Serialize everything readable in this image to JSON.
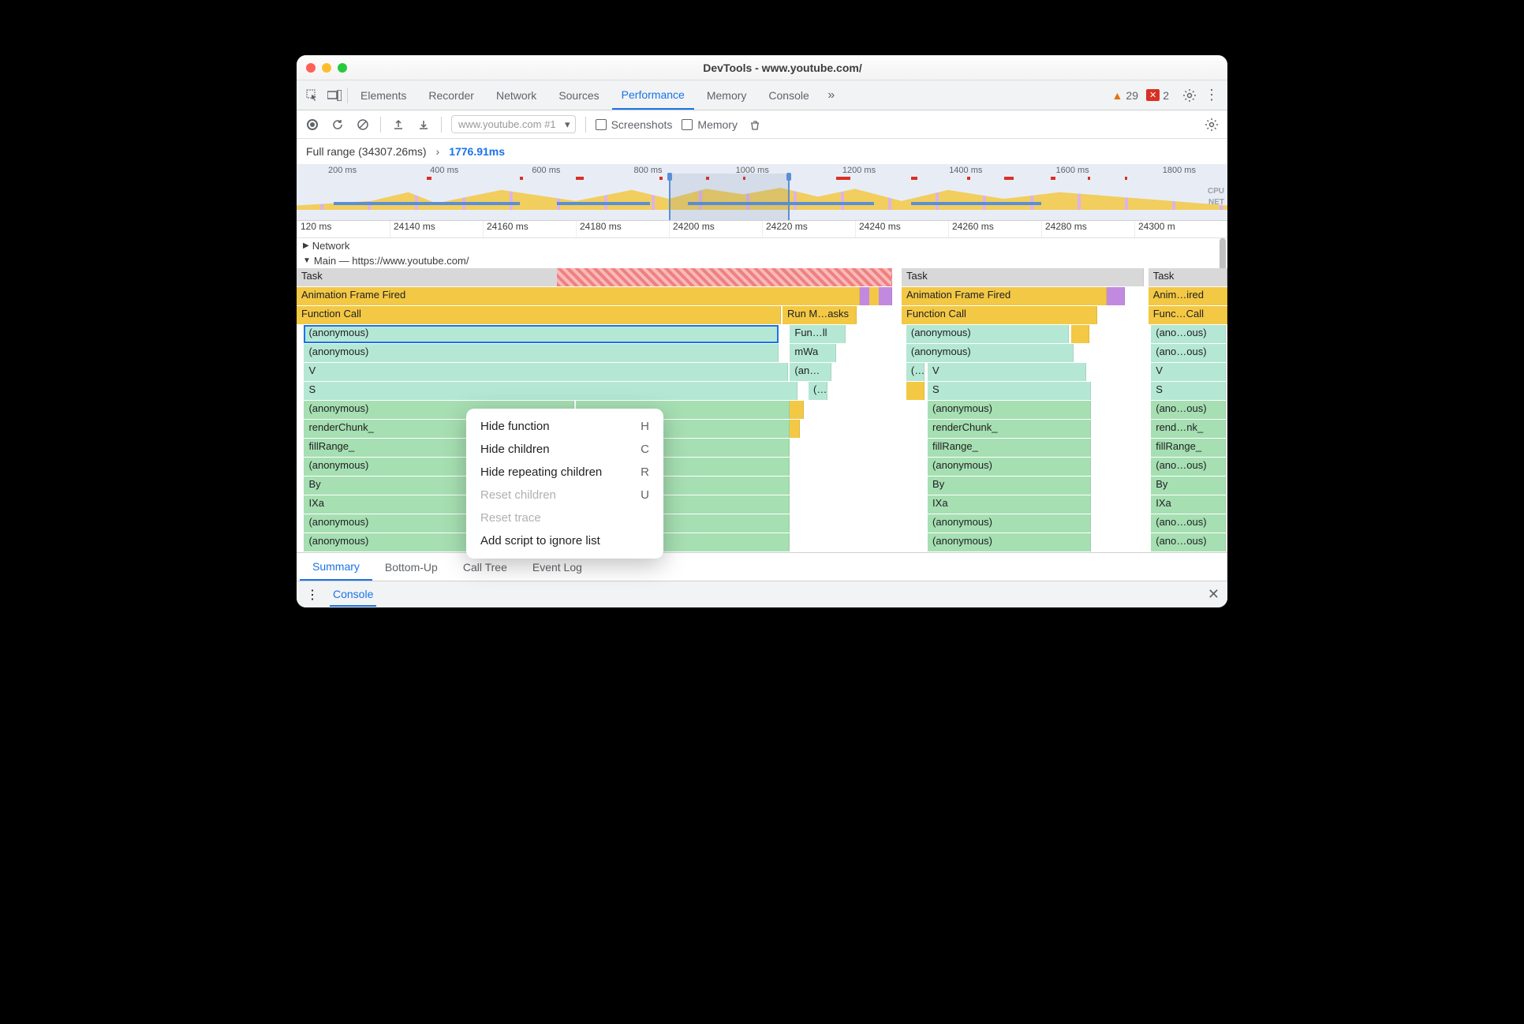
{
  "window_title": "DevTools - www.youtube.com/",
  "tabs": [
    "Elements",
    "Recorder",
    "Network",
    "Sources",
    "Performance",
    "Memory",
    "Console"
  ],
  "active_tab": "Performance",
  "warnings_count": "29",
  "errors_count": "2",
  "recording_select": "www.youtube.com #1",
  "checkboxes": {
    "screenshots": "Screenshots",
    "memory": "Memory"
  },
  "breadcrumb": {
    "full": "Full range (34307.26ms)",
    "selected": "1776.91ms"
  },
  "overview_ticks": [
    "200 ms",
    "400 ms",
    "600 ms",
    "800 ms",
    "1000 ms",
    "1200 ms",
    "1400 ms",
    "1600 ms",
    "1800 ms"
  ],
  "overview_labels": {
    "cpu": "CPU",
    "net": "NET"
  },
  "ruler_ticks": [
    "120 ms",
    "24140 ms",
    "24160 ms",
    "24180 ms",
    "24200 ms",
    "24220 ms",
    "24240 ms",
    "24260 ms",
    "24280 ms",
    "24300 m"
  ],
  "track_network": "Network",
  "track_main": "Main — https://www.youtube.com/",
  "flame_col1": {
    "task": "Task",
    "af": "Animation Frame Fired",
    "fc": "Function Call",
    "anon1": "(anonymous)",
    "anon2": "(anonymous)",
    "v": "V",
    "s": "S",
    "anon3": "(anonymous)",
    "render": "renderChunk_",
    "fill": "fillRange_",
    "anon4": "(anonymous)",
    "by": "By",
    "ixa": "IXa",
    "anon5": "(anonymous)",
    "anon6": "(anonymous)",
    "runm": "Run M…asks",
    "funll": "Fun…ll",
    "mwa": "mWa",
    "ans": "(an…s)",
    "paren": "(…"
  },
  "flame_col2": {
    "task": "Task",
    "af": "Animation Frame Fired",
    "fc": "Function Call",
    "anon1": "(anonymous)",
    "anon2": "(anonymous)",
    "p": "(…",
    "v": "V",
    "s": "S",
    "anon3": "(anonymous)",
    "render": "renderChunk_",
    "fill": "fillRange_",
    "anon4": "(anonymous)",
    "by": "By",
    "ixa": "IXa",
    "anon5": "(anonymous)",
    "anon6": "(anonymous)"
  },
  "flame_col3": {
    "task": "Task",
    "af": "Anim…ired",
    "fc": "Func…Call",
    "anon1": "(ano…ous)",
    "anon2": "(ano…ous)",
    "v": "V",
    "s": "S",
    "anon3": "(ano…ous)",
    "render": "rend…nk_",
    "fill": "fillRange_",
    "anon4": "(ano…ous)",
    "by": "By",
    "ixa": "IXa",
    "anon5": "(ano…ous)",
    "anon6": "(ano…ous)"
  },
  "context_menu": [
    {
      "label": "Hide function",
      "key": "H",
      "enabled": true
    },
    {
      "label": "Hide children",
      "key": "C",
      "enabled": true
    },
    {
      "label": "Hide repeating children",
      "key": "R",
      "enabled": true
    },
    {
      "label": "Reset children",
      "key": "U",
      "enabled": false
    },
    {
      "label": "Reset trace",
      "key": "",
      "enabled": false
    },
    {
      "label": "Add script to ignore list",
      "key": "",
      "enabled": true
    }
  ],
  "bottom_tabs": [
    "Summary",
    "Bottom-Up",
    "Call Tree",
    "Event Log"
  ],
  "active_bottom_tab": "Summary",
  "console_label": "Console"
}
